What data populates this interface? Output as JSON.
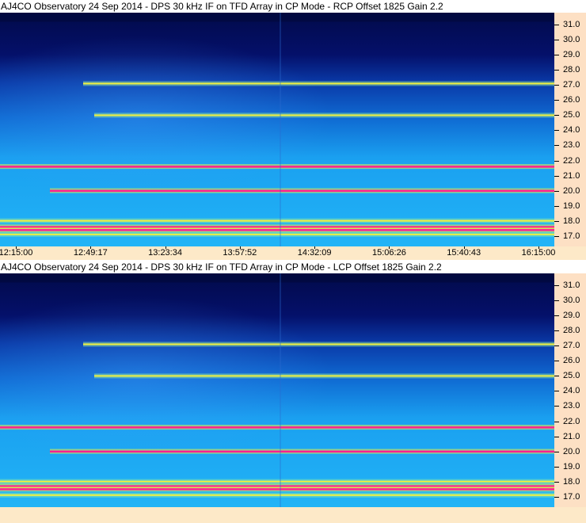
{
  "panels": [
    {
      "title": "AJ4CO Observatory 24 Sep 2014 - DPS 30 kHz IF on TFD Array in CP Mode - RCP     Offset 1825  Gain 2.2",
      "polarization": "RCP"
    },
    {
      "title": "AJ4CO Observatory 24 Sep 2014 - DPS 30 kHz IF on TFD Array in CP Mode - LCP     Offset 1825  Gain 2.2",
      "polarization": "LCP"
    }
  ],
  "x_ticks": [
    "12:15:00",
    "12:49:17",
    "13:23:34",
    "13:57:52",
    "14:32:09",
    "15:06:26",
    "15:40:43",
    "16:15:00"
  ],
  "y_ticks": [
    "31.0",
    "30.0",
    "29.0",
    "28.0",
    "27.0",
    "26.0",
    "25.0",
    "24.0",
    "23.0",
    "22.0",
    "21.0",
    "20.0",
    "19.0",
    "18.0",
    "17.0"
  ],
  "colors": {
    "title_bg": "#ffffff",
    "axis_bg": "#fde0c4",
    "xaxis_bg": "#fde9c8",
    "background_low": "#04106a",
    "background_high": "#1aa0f0",
    "band_strong": "#ff2090",
    "band_medium": "#f0f040"
  },
  "chart_data": [
    {
      "type": "heatmap",
      "title": "AJ4CO Observatory 24 Sep 2014 - DPS 30 kHz IF on TFD Array in CP Mode - RCP     Offset 1825  Gain 2.2",
      "x_start": "12:15:00",
      "x_end": "16:15:00",
      "xticks": [
        "12:15:00",
        "12:49:17",
        "13:23:34",
        "13:57:52",
        "14:32:09",
        "15:06:26",
        "15:40:43",
        "16:15:00"
      ],
      "yticks": [
        31.0,
        30.0,
        29.0,
        28.0,
        27.0,
        26.0,
        25.0,
        24.0,
        23.0,
        22.0,
        21.0,
        20.0,
        19.0,
        18.0,
        17.0
      ],
      "ylim": [
        16.3,
        31.8
      ],
      "bands": [
        {
          "freq": 27.1,
          "x0": 0.15,
          "x1": 1.0,
          "intensity": "medium"
        },
        {
          "freq": 25.0,
          "x0": 0.17,
          "x1": 1.0,
          "intensity": "medium"
        },
        {
          "freq": 21.6,
          "x0": 0.0,
          "x1": 1.0,
          "intensity": "strong"
        },
        {
          "freq": 20.0,
          "x0": 0.09,
          "x1": 1.0,
          "intensity": "strong"
        },
        {
          "freq": 18.0,
          "x0": 0.0,
          "x1": 1.0,
          "intensity": "medium"
        },
        {
          "freq": 17.6,
          "x0": 0.0,
          "x1": 1.0,
          "intensity": "strong"
        },
        {
          "freq": 17.4,
          "x0": 0.0,
          "x1": 1.0,
          "intensity": "strong"
        },
        {
          "freq": 17.1,
          "x0": 0.0,
          "x1": 1.0,
          "intensity": "medium"
        }
      ]
    },
    {
      "type": "heatmap",
      "title": "AJ4CO Observatory 24 Sep 2014 - DPS 30 kHz IF on TFD Array in CP Mode - LCP     Offset 1825  Gain 2.2",
      "x_start": "12:15:00",
      "x_end": "16:15:00",
      "xticks": [],
      "yticks": [
        31.0,
        30.0,
        29.0,
        28.0,
        27.0,
        26.0,
        25.0,
        24.0,
        23.0,
        22.0,
        21.0,
        20.0,
        19.0,
        18.0,
        17.0
      ],
      "ylim": [
        16.3,
        31.8
      ],
      "bands": [
        {
          "freq": 27.1,
          "x0": 0.15,
          "x1": 1.0,
          "intensity": "medium"
        },
        {
          "freq": 25.0,
          "x0": 0.17,
          "x1": 1.0,
          "intensity": "medium"
        },
        {
          "freq": 21.6,
          "x0": 0.0,
          "x1": 1.0,
          "intensity": "strong"
        },
        {
          "freq": 20.0,
          "x0": 0.09,
          "x1": 1.0,
          "intensity": "strong"
        },
        {
          "freq": 18.0,
          "x0": 0.0,
          "x1": 1.0,
          "intensity": "medium"
        },
        {
          "freq": 17.7,
          "x0": 0.0,
          "x1": 1.0,
          "intensity": "strong"
        },
        {
          "freq": 17.5,
          "x0": 0.0,
          "x1": 1.0,
          "intensity": "strong"
        },
        {
          "freq": 17.1,
          "x0": 0.0,
          "x1": 1.0,
          "intensity": "medium"
        }
      ]
    }
  ]
}
